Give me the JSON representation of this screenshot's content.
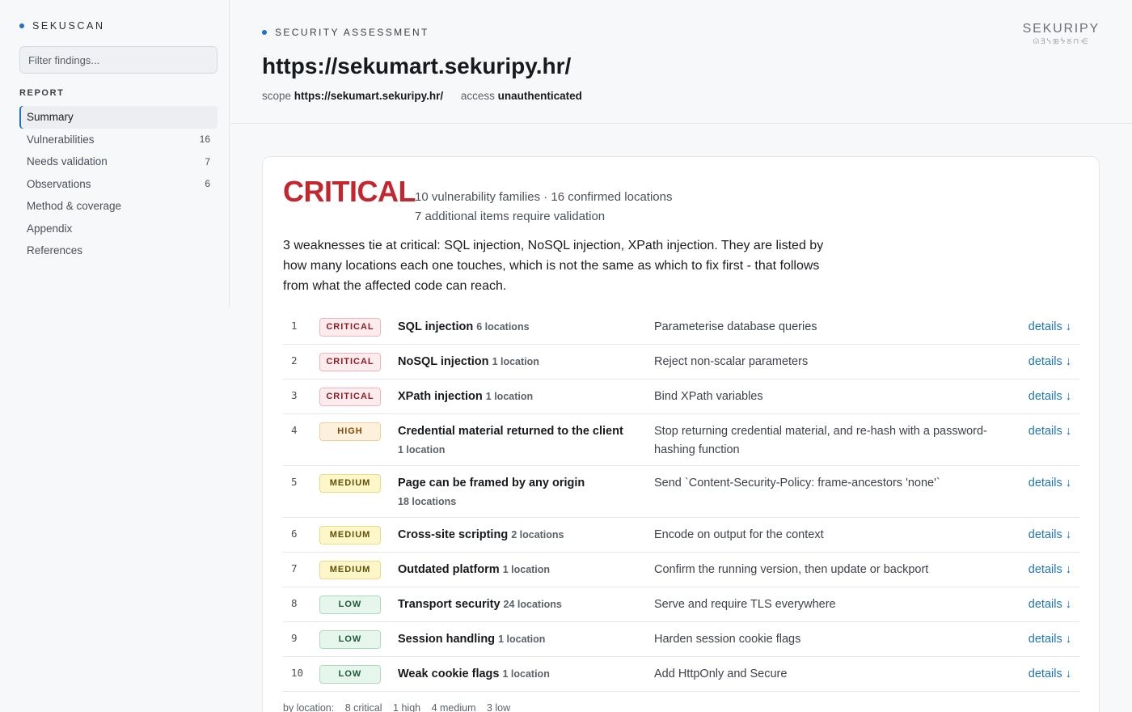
{
  "sidebar": {
    "brand": "SEKUSCAN",
    "filter_placeholder": "Filter findings...",
    "section_label": "REPORT",
    "items": [
      {
        "label": "Summary",
        "count": ""
      },
      {
        "label": "Vulnerabilities",
        "count": "16"
      },
      {
        "label": "Needs validation",
        "count": "7"
      },
      {
        "label": "Observations",
        "count": "6"
      },
      {
        "label": "Method & coverage",
        "count": ""
      },
      {
        "label": "Appendix",
        "count": ""
      },
      {
        "label": "References",
        "count": ""
      }
    ]
  },
  "header": {
    "eyebrow": "SECURITY ASSESSMENT",
    "title": "https://sekumart.sekuripy.hr/",
    "scope_label": "scope",
    "scope_value": "https://sekumart.sekuripy.hr/",
    "access_label": "access",
    "access_value": "unauthenticated",
    "logo_text": "SEKURIPY",
    "logo_sub": "ᘏ∃ᓭ⊞ᖭᘜ⊓⋲"
  },
  "colors": {
    "accent": "#1f73c4",
    "critical": "#c4262e"
  },
  "summary": {
    "severity": "CRITICAL",
    "line1": "10 vulnerability families · 16 confirmed locations",
    "line2": "7 additional items require validation",
    "intro": "3 weaknesses tie at critical: SQL injection, NoSQL injection, XPath injection. They are listed by how many locations each one touches, which is not the same as which to fix first - that follows from what the affected code can reach.",
    "details_label": "details ↓",
    "findings": [
      {
        "num": "1",
        "severity": "CRITICAL",
        "name": "SQL injection",
        "locations": "6 locations",
        "fix": "Parameterise database queries"
      },
      {
        "num": "2",
        "severity": "CRITICAL",
        "name": "NoSQL injection",
        "locations": "1 location",
        "fix": "Reject non-scalar parameters"
      },
      {
        "num": "3",
        "severity": "CRITICAL",
        "name": "XPath injection",
        "locations": "1 location",
        "fix": "Bind XPath variables"
      },
      {
        "num": "4",
        "severity": "HIGH",
        "name": "Credential material returned to the client",
        "locations": "1 location",
        "fix": "Stop returning credential material, and re-hash with a password-hashing function"
      },
      {
        "num": "5",
        "severity": "MEDIUM",
        "name": "Page can be framed by any origin",
        "locations": "18 locations",
        "fix": "Send `Content-Security-Policy: frame-ancestors 'none'`"
      },
      {
        "num": "6",
        "severity": "MEDIUM",
        "name": "Cross-site scripting",
        "locations": "2 locations",
        "fix": "Encode on output for the context"
      },
      {
        "num": "7",
        "severity": "MEDIUM",
        "name": "Outdated platform",
        "locations": "1 location",
        "fix": "Confirm the running version, then update or backport"
      },
      {
        "num": "8",
        "severity": "LOW",
        "name": "Transport security",
        "locations": "24 locations",
        "fix": "Serve and require TLS everywhere"
      },
      {
        "num": "9",
        "severity": "LOW",
        "name": "Session handling",
        "locations": "1 location",
        "fix": "Harden session cookie flags"
      },
      {
        "num": "10",
        "severity": "LOW",
        "name": "Weak cookie flags",
        "locations": "1 location",
        "fix": "Add HttpOnly and Secure"
      }
    ],
    "footer": {
      "label": "by location:",
      "critical": "8 critical",
      "high": "1 high",
      "medium": "4 medium",
      "low": "3 low"
    }
  }
}
